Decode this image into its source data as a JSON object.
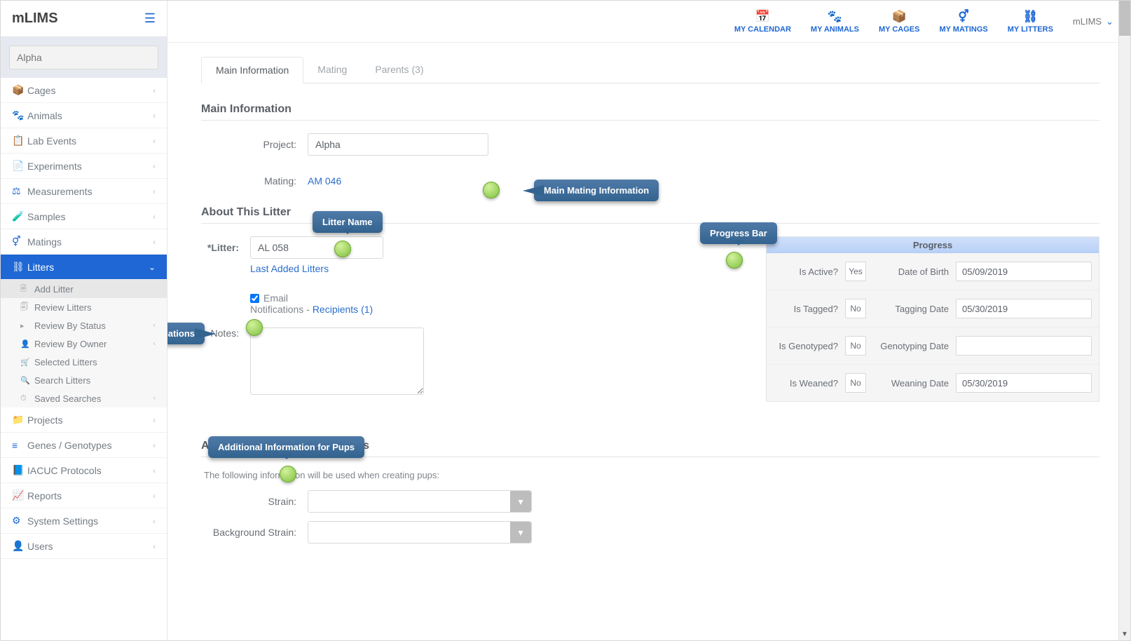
{
  "app_name": "mLIMS",
  "search_value": "Alpha",
  "top_nav": [
    {
      "icon": "📅",
      "label": "MY CALENDAR"
    },
    {
      "icon": "🐾",
      "label": "MY ANIMALS"
    },
    {
      "icon": "📦",
      "label": "MY CAGES"
    },
    {
      "icon": "⚥",
      "label": "MY MATINGS"
    },
    {
      "icon": "⛓",
      "label": "MY LITTERS"
    }
  ],
  "user_label": "mLIMS",
  "sidebar": [
    {
      "icon": "📦",
      "label": "Cages"
    },
    {
      "icon": "🐾",
      "label": "Animals"
    },
    {
      "icon": "📋",
      "label": "Lab Events"
    },
    {
      "icon": "📄",
      "label": "Experiments"
    },
    {
      "icon": "⚖",
      "label": "Measurements"
    },
    {
      "icon": "🧪",
      "label": "Samples"
    },
    {
      "icon": "⚥",
      "label": "Matings"
    },
    {
      "icon": "⛓",
      "label": "Litters",
      "active": true
    },
    {
      "icon": "📁",
      "label": "Projects"
    },
    {
      "icon": "≡",
      "label": "Genes / Genotypes"
    },
    {
      "icon": "📘",
      "label": "IACUC Protocols"
    },
    {
      "icon": "📈",
      "label": "Reports"
    },
    {
      "icon": "⚙",
      "label": "System Settings"
    },
    {
      "icon": "👤",
      "label": "Users"
    }
  ],
  "litters_sub": [
    {
      "icon": "🗎",
      "label": "Add Litter",
      "selected": true
    },
    {
      "icon": "🗐",
      "label": "Review Litters"
    },
    {
      "icon": "▸",
      "label": "Review By Status",
      "chev": true
    },
    {
      "icon": "👤",
      "label": "Review By Owner",
      "chev": true
    },
    {
      "icon": "🛒",
      "label": "Selected Litters"
    },
    {
      "icon": "🔍",
      "label": "Search Litters"
    },
    {
      "icon": "⏱",
      "label": "Saved Searches",
      "chev": true
    }
  ],
  "tabs": [
    {
      "label": "Main Information",
      "active": true
    },
    {
      "label": "Mating"
    },
    {
      "label": "Parents (3)"
    }
  ],
  "sections": {
    "main_info_title": "Main Information",
    "project_label": "Project:",
    "project_value": "Alpha",
    "mating_label": "Mating:",
    "mating_value": "AM 046",
    "about_title": "About This Litter",
    "litter_label": "*Litter:",
    "litter_value": "AL 058",
    "last_added": "Last Added Litters",
    "email_label": "Email",
    "notifications_label": "Notifications - ",
    "recipients": "Recipients (1)",
    "notes_label": "Notes:",
    "additional_title": "Additional Information for Pups",
    "additional_note": "The following information will be used when creating pups:",
    "strain_label": "Strain:",
    "bg_strain_label": "Background Strain:"
  },
  "progress": {
    "title": "Progress",
    "rows": [
      {
        "q": "Is Active?",
        "badge": "Yes",
        "dlabel": "Date of Birth",
        "dval": "05/09/2019"
      },
      {
        "q": "Is Tagged?",
        "badge": "No",
        "dlabel": "Tagging Date",
        "dval": "05/30/2019"
      },
      {
        "q": "Is Genotyped?",
        "badge": "No",
        "dlabel": "Genotyping Date",
        "dval": ""
      },
      {
        "q": "Is Weaned?",
        "badge": "No",
        "dlabel": "Weaning Date",
        "dval": "05/30/2019"
      }
    ]
  },
  "callouts": {
    "email": "Email Notifications",
    "litter_name": "Litter Name",
    "main_mating": "Main Mating Information",
    "progress_bar": "Progress Bar",
    "additional": "Additional Information for Pups"
  }
}
